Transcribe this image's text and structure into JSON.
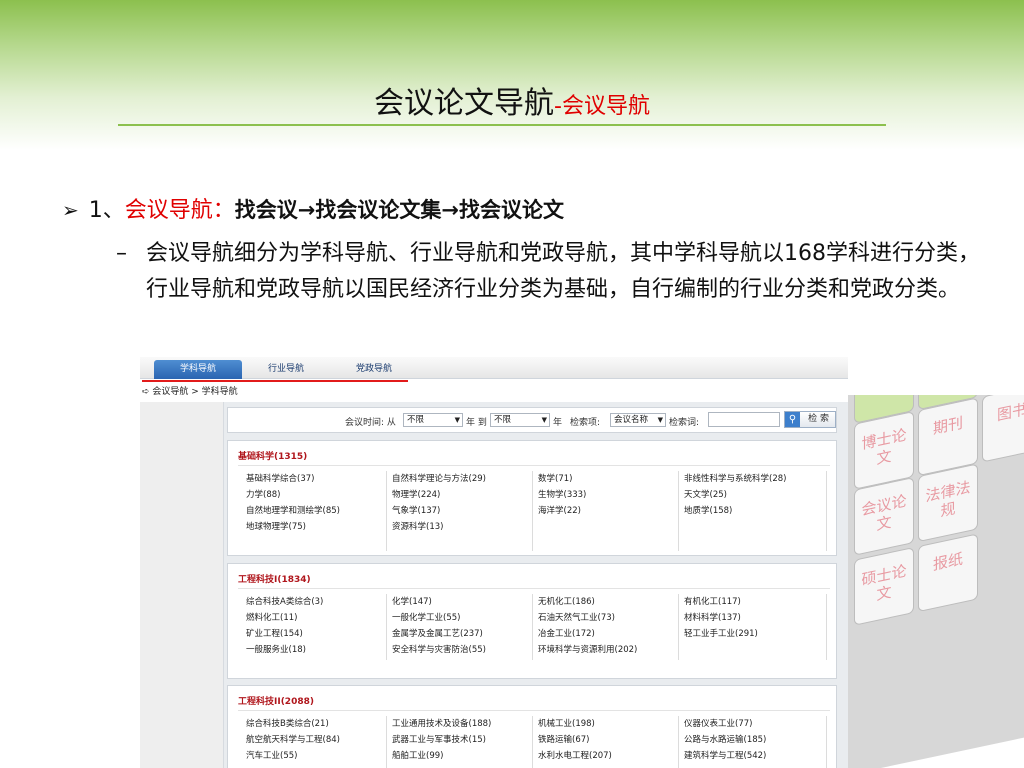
{
  "slide": {
    "title": "会议论文导航",
    "title_suffix": "-会议导航",
    "bullet1_arrow": "➢",
    "bullet1_num": "1、",
    "bullet1_red": "会议导航：",
    "bullet1_rest": "找会议→找会议论文集→找会议论文",
    "bullet2_dash": "–",
    "bullet2_text": "会议导航细分为学科导航、行业导航和党政导航，其中学科导航以168学科进行分类，行业导航和党政导航以国民经济行业分类为基础，自行编制的行业分类和党政分类。"
  },
  "cube": {
    "tiles": [
      "博士论文",
      "期刊",
      "图书",
      "会议论文",
      "法律法规",
      "硕士论文",
      "报纸"
    ]
  },
  "shot": {
    "tabs": [
      "学科导航",
      "行业导航",
      "党政导航"
    ],
    "breadcrumb": "➪ 会议导航 > 学科导航",
    "search": {
      "time_label": "会议时间: 从",
      "from_value": "不限",
      "year_to": "年 到",
      "to_value": "不限",
      "year": "年",
      "field_label": "检索项:",
      "field_value": "会议名称",
      "keyword_label": "检索词:",
      "keyword_value": "",
      "search_button": "检 索"
    },
    "sections": [
      {
        "title": "基础科学(1315)",
        "items": [
          "基础科学综合(37)",
          "自然科学理论与方法(29)",
          "数学(71)",
          "非线性科学与系统科学(28)",
          "力学(88)",
          "物理学(224)",
          "生物学(333)",
          "天文学(25)",
          "自然地理学和测绘学(85)",
          "气象学(137)",
          "海洋学(22)",
          "地质学(158)",
          "地球物理学(75)",
          "资源科学(13)"
        ]
      },
      {
        "title": "工程科技I(1834)",
        "items": [
          "综合科技A类综合(3)",
          "化学(147)",
          "无机化工(186)",
          "有机化工(117)",
          "燃料化工(11)",
          "一般化学工业(55)",
          "石油天然气工业(73)",
          "材料科学(137)",
          "矿业工程(154)",
          "金属学及金属工艺(237)",
          "冶金工业(172)",
          "轻工业手工业(291)",
          "一般服务业(18)",
          "安全科学与灾害防治(55)",
          "环境科学与资源利用(202)"
        ]
      },
      {
        "title": "工程科技II(2088)",
        "items": [
          "综合科技B类综合(21)",
          "工业通用技术及设备(188)",
          "机械工业(198)",
          "仪器仪表工业(77)",
          "航空航天科学与工程(84)",
          "武器工业与军事技术(15)",
          "铁路运输(67)",
          "公路与水路运输(185)",
          "汽车工业(55)",
          "船舶工业(99)",
          "水利水电工程(207)",
          "建筑科学与工程(542)"
        ]
      }
    ]
  },
  "colors": {
    "accent_green": "#8cc04e",
    "title_red": "#e00000",
    "section_red": "#b0161c",
    "tab_blue": "#2a64b1"
  }
}
